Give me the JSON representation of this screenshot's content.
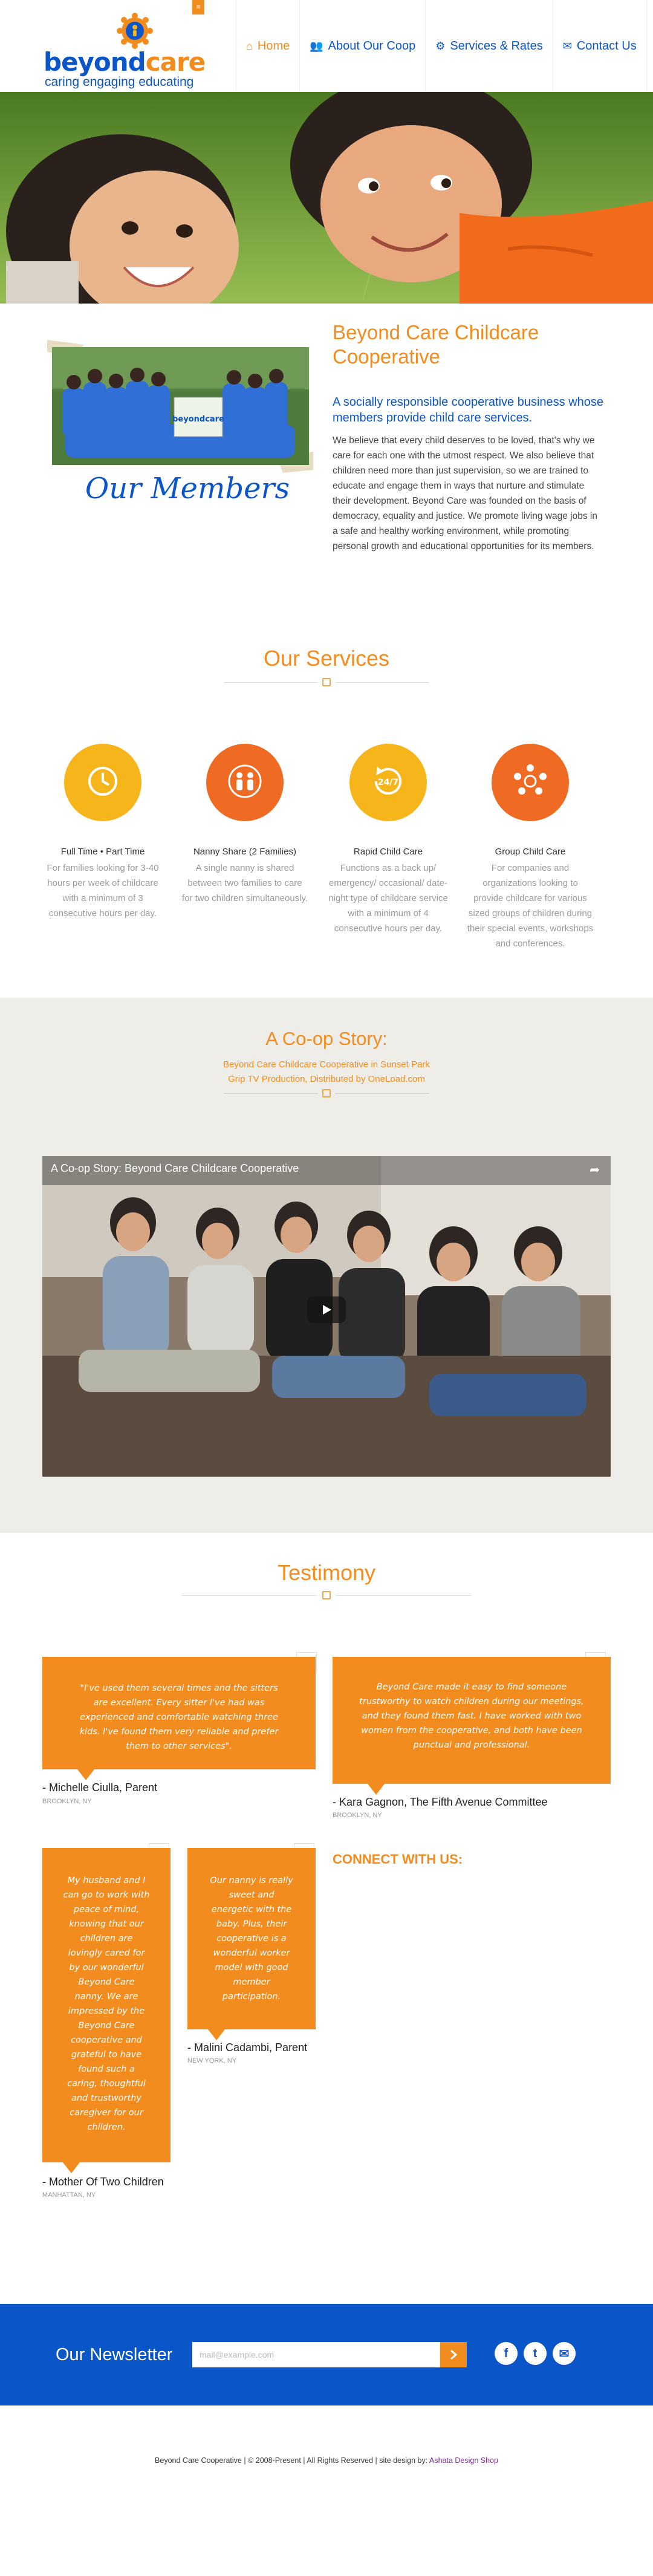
{
  "brand": {
    "name_part1": "beyond",
    "name_part2": "care",
    "tagline": "caring engaging educating"
  },
  "nav": {
    "items": [
      {
        "label": "Home",
        "icon": "home-icon",
        "active": true
      },
      {
        "label": "About Our Coop",
        "icon": "users-icon",
        "active": false
      },
      {
        "label": "Services & Rates",
        "icon": "gear-icon",
        "active": false
      },
      {
        "label": "Contact Us",
        "icon": "envelope-icon",
        "active": false
      }
    ]
  },
  "about": {
    "members_caption": "Our Members",
    "photo_banner_text": "beyondcare",
    "title": "Beyond Care Childcare Cooperative",
    "subtitle": "A socially responsible cooperative business whose members provide child care services.",
    "body": "We believe that every child deserves to be loved, that's why we care for each one with the utmost respect. We also believe that children need more than just supervision, so we are trained to educate and engage them in ways that nurture and stimulate their development. Beyond Care was founded on the basis of democracy, equality and justice. We promote living wage jobs in a safe and healthy working environment, while promoting personal growth and educational opportunities for its members."
  },
  "services": {
    "heading": "Our Services",
    "items": [
      {
        "title": "Full Time • Part Time",
        "icon": "clock-icon",
        "color": "#f7b51c",
        "desc": "For families looking for 3-40 hours per week of childcare with a minimum of 3 consecutive hours per day."
      },
      {
        "title": "Nanny Share (2 Families)",
        "icon": "family-icon",
        "color": "#ef6a22",
        "desc": "A single nanny is shared between two families to care for two children simultaneously."
      },
      {
        "title": "Rapid Child Care",
        "icon": "24-7-icon",
        "color": "#f7b51c",
        "desc": "Functions as a back up/ emergency/ occasional/ date-night type of childcare service with a minimum of 4 consecutive hours per day.",
        "badge": "24/7"
      },
      {
        "title": "Group Child Care",
        "icon": "group-circle-icon",
        "color": "#ef6a22",
        "desc": "For companies and organizations looking to provide childcare for various sized groups of children during their special events, workshops and conferences."
      }
    ]
  },
  "story": {
    "heading": "A Co-op Story:",
    "line1": "Beyond Care Childcare Cooperative in Sunset Park",
    "line2": "Grip TV Production, Distributed by OneLoad.com",
    "video_title": "A Co-op Story: Beyond Care Childcare Cooperative"
  },
  "testimony": {
    "heading": "Testimony",
    "connect_heading": "CONNECT WITH US:",
    "items": [
      {
        "quote": "\"I've used them several times and the sitters are excellent. Every sitter I've had was experienced and comfortable watching three kids. I've found them very reliable and prefer them to other services\".",
        "name": "- Michelle Ciulla, Parent",
        "location": "BROOKLYN, NY"
      },
      {
        "quote": "Beyond Care made it easy to find someone trustworthy to watch children during our meetings, and they found them fast. I have worked with two women from the cooperative, and both have been punctual and professional.",
        "name": "- Kara Gagnon, The Fifth Avenue Committee",
        "location": "BROOKLYN, NY"
      },
      {
        "quote": "My husband and I can go to work with peace of mind, knowing that our children are lovingly cared for by our wonderful Beyond Care nanny. We are impressed by the Beyond Care cooperative and grateful to have found such a caring, thoughtful and trustworthy caregiver for our children.",
        "name": "- Mother Of Two Children",
        "location": "MANHATTAN, NY"
      },
      {
        "quote": "Our nanny is really sweet and energetic with the baby. Plus, their cooperative is a wonderful worker model with good member participation.",
        "name": "- Malini Cadambi, Parent",
        "location": "NEW YORK, NY"
      }
    ]
  },
  "newsletter": {
    "heading": "Our Newsletter",
    "placeholder": "mail@example.com",
    "social": [
      {
        "icon": "facebook-icon",
        "glyph": "f"
      },
      {
        "icon": "twitter-icon",
        "glyph": "t"
      },
      {
        "icon": "mail-icon",
        "glyph": "✉"
      }
    ]
  },
  "footer": {
    "text": "Beyond Care Cooperative | © 2008-Present | All Rights Reserved | site design by:",
    "credit": "Ashata Design Shop"
  }
}
